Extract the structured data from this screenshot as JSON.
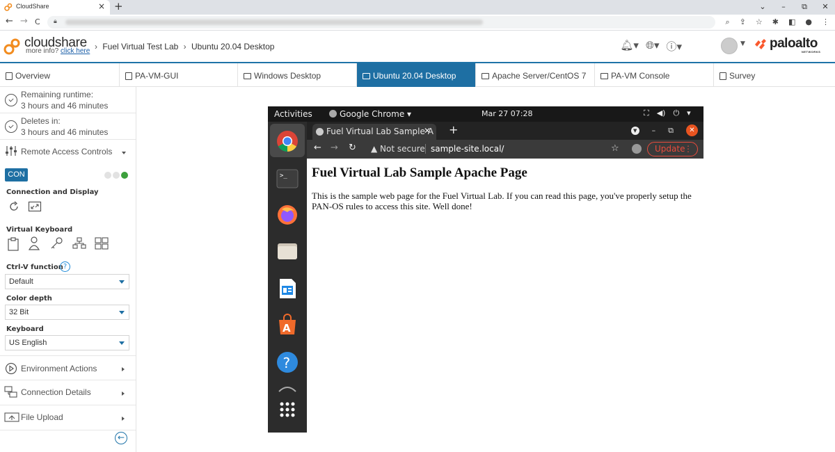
{
  "browser": {
    "tab_title": "CloudShare",
    "tab_close": "×",
    "new_tab": "+",
    "win_controls": [
      "⌄",
      "–",
      "⧉",
      "✕"
    ],
    "nav": {
      "back": "←",
      "forward": "→",
      "reload": "C"
    }
  },
  "header": {
    "brand": "cloudshare",
    "more_info_prefix": "more info?",
    "more_info_link": "click here",
    "breadcrumbs": [
      "Fuel Virtual Test Lab",
      "Ubuntu 20.04 Desktop"
    ],
    "partner_logo": "paloalto",
    "partner_sub": "NETWORKS",
    "icons": [
      "bell-icon",
      "globe-icon",
      "help-icon"
    ]
  },
  "tabs": [
    {
      "label": "Overview",
      "icon": "doc"
    },
    {
      "label": "PA-VM-GUI",
      "icon": "doc"
    },
    {
      "label": "Windows Desktop",
      "icon": "monitor"
    },
    {
      "label": "Ubuntu 20.04 Desktop",
      "icon": "monitor",
      "active": true
    },
    {
      "label": "Apache Server/CentOS 7",
      "icon": "monitor"
    },
    {
      "label": "PA-VM Console",
      "icon": "monitor"
    },
    {
      "label": "Survey",
      "icon": "doc"
    }
  ],
  "sidebar": {
    "remaining_label": "Remaining runtime:",
    "remaining_value": "3 hours and 46 minutes",
    "deletes_label": "Deletes in:",
    "deletes_value": "3 hours and 46 minutes",
    "remote_access": "Remote Access Controls",
    "con_badge": "CON",
    "connection_display": "Connection and Display",
    "virtual_keyboard": "Virtual Keyboard",
    "ctrlv_label": "Ctrl-V function",
    "ctrlv_value": "Default",
    "color_depth_label": "Color depth",
    "color_depth_value": "32 Bit",
    "keyboard_label": "Keyboard",
    "keyboard_value": "US English",
    "environment_actions": "Environment Actions",
    "connection_details": "Connection Details",
    "file_upload": "File Upload"
  },
  "ubuntu": {
    "activities": "Activities",
    "app_name": "Google Chrome ▾",
    "clock": "Mar 27  07:28",
    "tray": [
      "⛶",
      "◀)",
      "⏻",
      "▾"
    ]
  },
  "chrome": {
    "tab_title": "Fuel Virtual Lab Sample A",
    "tab_close": "✕",
    "new_tab": "+",
    "not_secure": "▲ Not secure",
    "url": "sample-site.local/",
    "update_label": "Update",
    "update_menu": "⋮"
  },
  "webpage": {
    "heading": "Fuel Virtual Lab Sample Apache Page",
    "body": "This is the sample web page for the Fuel Virtual Lab. If you can read this page, you've properly setup the PAN-OS rules to access this site. Well done!"
  },
  "colors": {
    "accent": "#1e6fa3",
    "status_on": "#3ca03c",
    "ubuntu_orange": "#e95420"
  }
}
